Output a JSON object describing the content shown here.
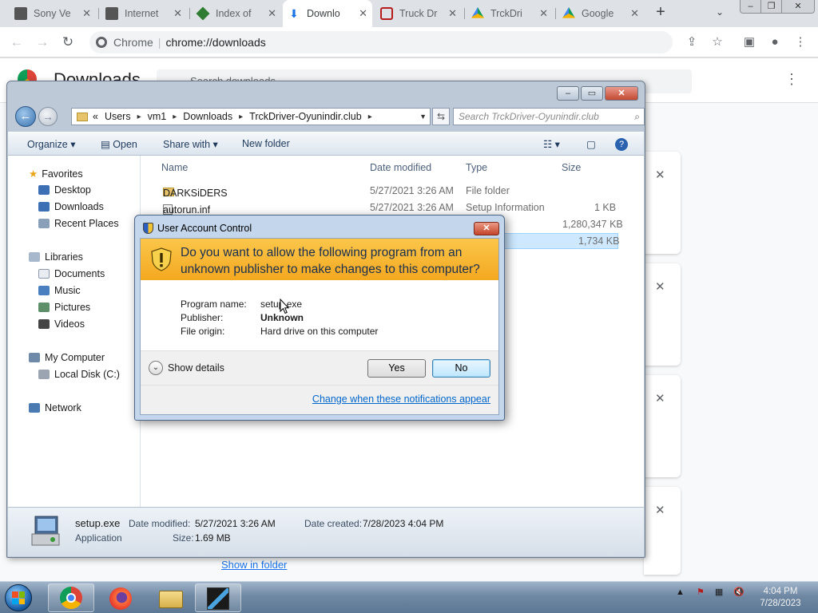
{
  "chrome": {
    "tabs": [
      {
        "title": "Sony Ve",
        "active": false
      },
      {
        "title": "Internet",
        "active": false
      },
      {
        "title": "Index of",
        "active": false
      },
      {
        "title": "Downlo",
        "active": true
      },
      {
        "title": "Truck Dr",
        "active": false
      },
      {
        "title": "TrckDri",
        "active": false
      },
      {
        "title": "Google",
        "active": false
      }
    ],
    "new_tab": "+",
    "omnibox_label": "Chrome",
    "url": "chrome://downloads"
  },
  "downloads_page": {
    "title": "Downloads",
    "search_placeholder": "Search downloads",
    "show_in_folder": "Show in folder"
  },
  "explorer": {
    "breadcrumb": [
      "Users",
      "vm1",
      "Downloads",
      "TrckDriver-Oyunindir.club"
    ],
    "breadcrumb_prefix": "«",
    "search_placeholder": "Search TrckDriver-Oyunindir.club",
    "commands": {
      "organize": "Organize",
      "open": "Open",
      "share_with": "Share with",
      "new_folder": "New folder"
    },
    "nav": {
      "favorites": "Favorites",
      "desktop": "Desktop",
      "downloads": "Downloads",
      "recent_places": "Recent Places",
      "libraries": "Libraries",
      "documents": "Documents",
      "music": "Music",
      "pictures": "Pictures",
      "videos": "Videos",
      "my_computer": "My Computer",
      "local_disk": "Local Disk (C:)",
      "network": "Network"
    },
    "columns": {
      "name": "Name",
      "date_modified": "Date modified",
      "type": "Type",
      "size": "Size"
    },
    "files": [
      {
        "name": "DARKSiDERS",
        "date": "5/27/2021 3:26 AM",
        "type": "File folder",
        "size": ""
      },
      {
        "name": "autorun.inf",
        "date": "5/27/2021 3:26 AM",
        "type": "Setup Information",
        "size": "1 KB"
      },
      {
        "name": "",
        "date": "",
        "type": "",
        "size": "1,280,347 KB"
      },
      {
        "name": "",
        "date": "",
        "type": "",
        "size": "1,734 KB"
      }
    ],
    "details": {
      "file_name": "setup.exe",
      "file_kind": "Application",
      "date_modified_label": "Date modified:",
      "date_modified": "5/27/2021 3:26 AM",
      "size_label": "Size:",
      "size": "1.69 MB",
      "date_created_label": "Date created:",
      "date_created": "7/28/2023 4:04 PM"
    }
  },
  "uac": {
    "title": "User Account Control",
    "question": "Do you want to allow the following program from an unknown publisher to make changes to this computer?",
    "program_name_label": "Program name:",
    "program_name": "setup.exe",
    "publisher_label": "Publisher:",
    "publisher": "Unknown",
    "file_origin_label": "File origin:",
    "file_origin": "Hard drive on this computer",
    "show_details": "Show details",
    "yes": "Yes",
    "no": "No",
    "change_link": "Change when these notifications appear"
  },
  "taskbar": {
    "time": "4:04 PM",
    "date": "7/28/2023"
  },
  "colors": {
    "uac_banner": "#f4a820",
    "uac_frame": "#c3d6ec",
    "link": "#0066cc",
    "taskbar": "#6f88a4"
  }
}
